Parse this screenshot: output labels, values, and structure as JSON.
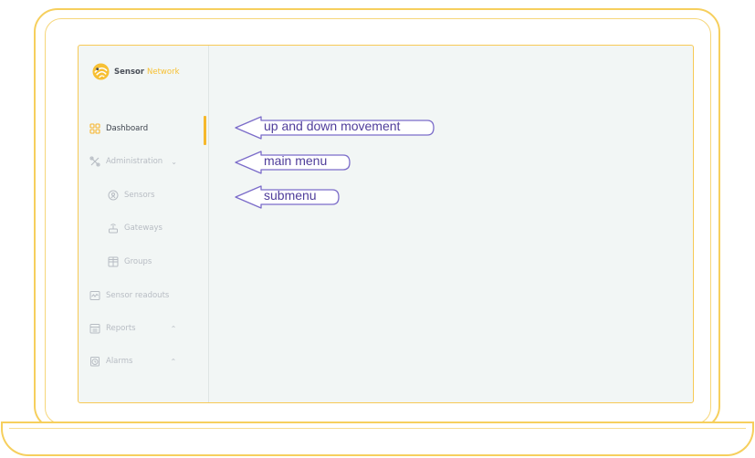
{
  "app": {
    "logo_word_1": "Sensor",
    "logo_word_2": "Network"
  },
  "sidebar": {
    "items": [
      {
        "label": "Dashboard",
        "icon": "dashboard-icon",
        "active": true
      },
      {
        "label": "Administration",
        "icon": "tools-icon",
        "chevron": "⌄"
      },
      {
        "label": "Sensors",
        "icon": "sensor-icon"
      },
      {
        "label": "Gateways",
        "icon": "gateway-icon"
      },
      {
        "label": "Groups",
        "icon": "groups-icon"
      },
      {
        "label": "Sensor readouts",
        "icon": "readouts-icon"
      },
      {
        "label": "Reports",
        "icon": "reports-icon",
        "chevron": "⌃"
      },
      {
        "label": "Alarms",
        "icon": "alarm-clock-icon",
        "chevron": "⌃"
      }
    ]
  },
  "annotations": {
    "up_down": "up and down movement",
    "main_menu": "main menu",
    "submenu": "submenu"
  },
  "colors": {
    "accent": "#f7c033",
    "frame": "#f6cf5d",
    "annotation": "#7b6cc9"
  }
}
